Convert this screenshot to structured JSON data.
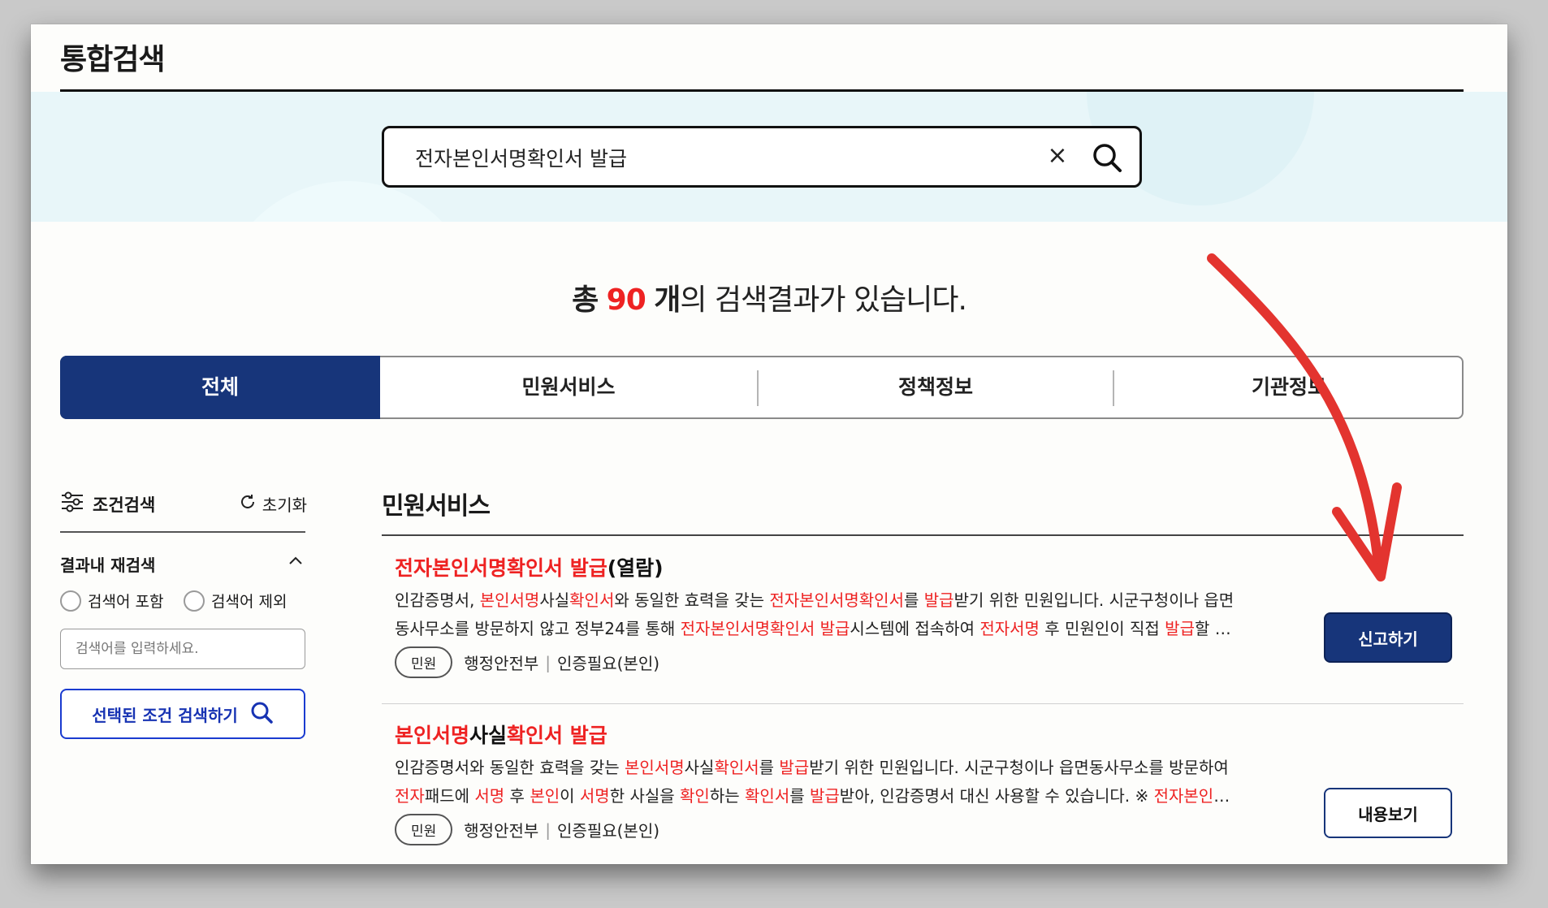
{
  "page": {
    "title": "통합검색"
  },
  "search": {
    "query": "전자본인서명확인서 발급",
    "clear_glyph": "×"
  },
  "summary": {
    "prefix": "총",
    "count": "90",
    "unit": "개",
    "suffix": "의 검색결과가 있습니다."
  },
  "tabs": [
    {
      "label": "전체",
      "active": true
    },
    {
      "label": "민원서비스",
      "active": false
    },
    {
      "label": "정책정보",
      "active": false
    },
    {
      "label": "기관정보",
      "active": false
    }
  ],
  "sidebar": {
    "filter_label": "조건검색",
    "reset_label": "초기화",
    "refine_label": "결과내 재검색",
    "toggle_glyph": "⌃",
    "include_label": "검색어 포함",
    "exclude_label": "검색어 제외",
    "input_placeholder": "검색어를 입력하세요.",
    "submit_label": "선택된 조건 검색하기"
  },
  "section": {
    "title": "민원서비스"
  },
  "results": [
    {
      "title": {
        "hl": "전자본인서명확인서 발급",
        "rest": "(열람)"
      },
      "desc_line1": [
        "인감증명서, ",
        {
          "hl": "본인서명"
        },
        "사실",
        {
          "hl": "확인서"
        },
        "와 동일한 효력을 갖는 ",
        {
          "hl": "전자본인서명확인서"
        },
        "를 ",
        {
          "hl": "발급"
        },
        "받기 위한 민원입니다. 시군구청이나 읍면"
      ],
      "desc_line2": [
        "동사무소를 방문하지 않고 정부24를 통해 ",
        {
          "hl": "전자본인서명확인서 발급"
        },
        "시스템에 접속하여 ",
        {
          "hl": "전자서명"
        },
        " 후 민원인이 직접 ",
        {
          "hl": "발급"
        },
        "할 …"
      ],
      "tag": "민원",
      "agency": "행정안전부",
      "auth": "인증필요(본인)",
      "action": "신고하기"
    },
    {
      "title": {
        "hl": "본인서명",
        "mid": "사실",
        "hl2": "확인서 발급"
      },
      "desc_line1": [
        "인감증명서와 동일한 효력을 갖는 ",
        {
          "hl": "본인서명"
        },
        "사실",
        {
          "hl": "확인서"
        },
        "를 ",
        {
          "hl": "발급"
        },
        "받기 위한 민원입니다. 시군구청이나 읍면동사무소를 방문하여"
      ],
      "desc_line2": [
        {
          "hl": "전자"
        },
        "패드에 ",
        {
          "hl": "서명"
        },
        " 후 ",
        {
          "hl": "본인"
        },
        "이 ",
        {
          "hl": "서명"
        },
        "한 사실을 ",
        {
          "hl": "확인"
        },
        "하는 ",
        {
          "hl": "확인서"
        },
        "를 ",
        {
          "hl": "발급"
        },
        "받아, 인감증명서 대신 사용할 수 있습니다. ※ ",
        {
          "hl": "전자본인"
        },
        "…"
      ],
      "tag": "민원",
      "agency": "행정안전부",
      "auth": "인증필요(본인)",
      "action": "내용보기"
    }
  ],
  "annotation": {
    "arrow_color": "#e3342f"
  },
  "colors": {
    "accent": "#17357a",
    "highlight": "#e22222",
    "band": "#e8f6f9"
  }
}
